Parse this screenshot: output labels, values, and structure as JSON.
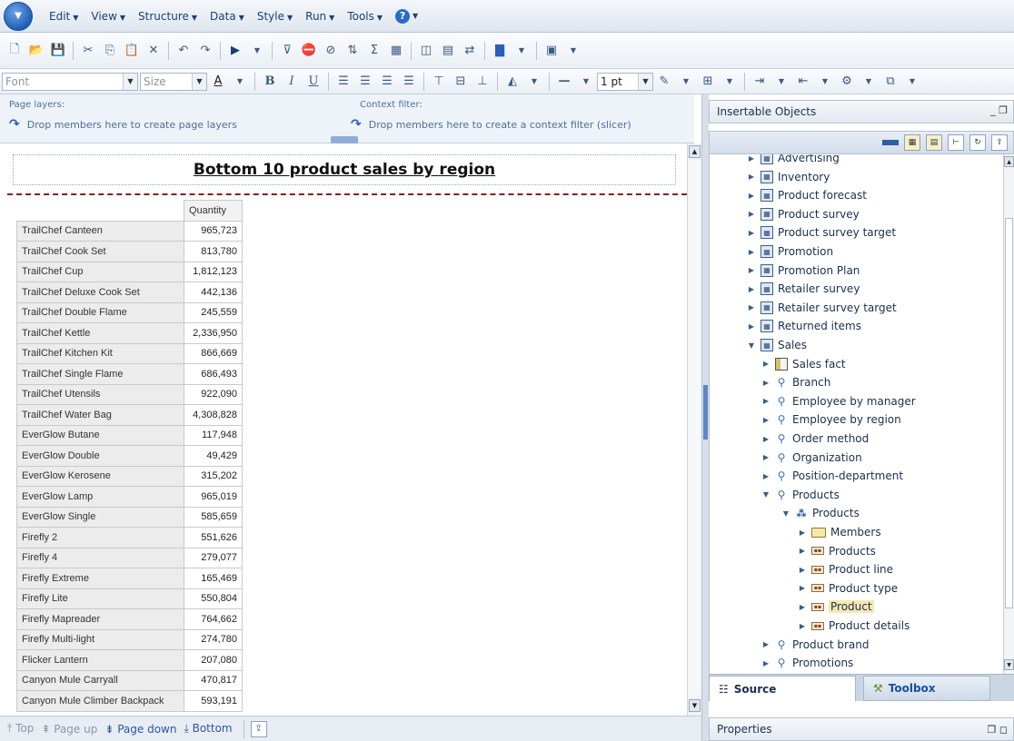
{
  "menu": {
    "items": [
      "Edit",
      "View",
      "Structure",
      "Data",
      "Style",
      "Run",
      "Tools"
    ]
  },
  "toolbar2": {
    "font_placeholder": "Font",
    "size_placeholder": "Size",
    "line_width": "1 pt",
    "bold": "B",
    "italic": "I",
    "underline": "U"
  },
  "layers": {
    "page_title": "Page layers:",
    "page_hint": "Drop members here to create page layers",
    "context_title": "Context filter:",
    "context_hint": "Drop members here to create a context filter (slicer)"
  },
  "report": {
    "title": "Bottom 10 product sales by region",
    "column_header": "Quantity",
    "rows": [
      {
        "label": "TrailChef Canteen",
        "value": "965,723"
      },
      {
        "label": "TrailChef Cook Set",
        "value": "813,780"
      },
      {
        "label": "TrailChef Cup",
        "value": "1,812,123"
      },
      {
        "label": "TrailChef Deluxe Cook Set",
        "value": "442,136"
      },
      {
        "label": "TrailChef Double Flame",
        "value": "245,559"
      },
      {
        "label": "TrailChef Kettle",
        "value": "2,336,950"
      },
      {
        "label": "TrailChef Kitchen Kit",
        "value": "866,669"
      },
      {
        "label": "TrailChef Single Flame",
        "value": "686,493"
      },
      {
        "label": "TrailChef Utensils",
        "value": "922,090"
      },
      {
        "label": "TrailChef Water Bag",
        "value": "4,308,828"
      },
      {
        "label": "EverGlow Butane",
        "value": "117,948"
      },
      {
        "label": "EverGlow Double",
        "value": "49,429"
      },
      {
        "label": "EverGlow Kerosene",
        "value": "315,202"
      },
      {
        "label": "EverGlow Lamp",
        "value": "965,019"
      },
      {
        "label": "EverGlow Single",
        "value": "585,659"
      },
      {
        "label": "Firefly 2",
        "value": "551,626"
      },
      {
        "label": "Firefly 4",
        "value": "279,077"
      },
      {
        "label": "Firefly Extreme",
        "value": "165,469"
      },
      {
        "label": "Firefly Lite",
        "value": "550,804"
      },
      {
        "label": "Firefly Mapreader",
        "value": "764,662"
      },
      {
        "label": "Firefly Multi-light",
        "value": "274,780"
      },
      {
        "label": "Flicker Lantern",
        "value": "207,080"
      },
      {
        "label": "Canyon Mule Carryall",
        "value": "470,817"
      },
      {
        "label": "Canyon Mule Climber Backpack",
        "value": "593,191"
      }
    ]
  },
  "page_nav": {
    "top": "Top",
    "page_up": "Page up",
    "page_down": "Page down",
    "bottom": "Bottom"
  },
  "insertable": {
    "title": "Insertable Objects"
  },
  "tree": [
    {
      "label": "Advertising",
      "level": 0,
      "icon": "qs",
      "expanded": false
    },
    {
      "label": "Inventory",
      "level": 0,
      "icon": "qs",
      "expanded": false
    },
    {
      "label": "Product forecast",
      "level": 0,
      "icon": "qs",
      "expanded": false
    },
    {
      "label": "Product survey",
      "level": 0,
      "icon": "qs",
      "expanded": false
    },
    {
      "label": "Product survey target",
      "level": 0,
      "icon": "qs",
      "expanded": false
    },
    {
      "label": "Promotion",
      "level": 0,
      "icon": "qs",
      "expanded": false
    },
    {
      "label": "Promotion Plan",
      "level": 0,
      "icon": "qs",
      "expanded": false
    },
    {
      "label": "Retailer survey",
      "level": 0,
      "icon": "qs",
      "expanded": false
    },
    {
      "label": "Retailer survey target",
      "level": 0,
      "icon": "qs",
      "expanded": false
    },
    {
      "label": "Returned items",
      "level": 0,
      "icon": "qs",
      "expanded": false
    },
    {
      "label": "Sales",
      "level": 0,
      "icon": "qs",
      "expanded": true
    },
    {
      "label": "Sales fact",
      "level": 1,
      "icon": "fact",
      "expanded": false
    },
    {
      "label": "Branch",
      "level": 1,
      "icon": "dim",
      "expanded": false
    },
    {
      "label": "Employee by manager",
      "level": 1,
      "icon": "dim",
      "expanded": false
    },
    {
      "label": "Employee by region",
      "level": 1,
      "icon": "dim",
      "expanded": false
    },
    {
      "label": "Order method",
      "level": 1,
      "icon": "dim",
      "expanded": false
    },
    {
      "label": "Organization",
      "level": 1,
      "icon": "dim",
      "expanded": false
    },
    {
      "label": "Position-department",
      "level": 1,
      "icon": "dim",
      "expanded": false
    },
    {
      "label": "Products",
      "level": 1,
      "icon": "dim",
      "expanded": true
    },
    {
      "label": "Products",
      "level": 2,
      "icon": "hier",
      "expanded": true
    },
    {
      "label": "Members",
      "level": 3,
      "icon": "folder",
      "expanded": false
    },
    {
      "label": "Products",
      "level": 3,
      "icon": "levelitem",
      "expanded": false
    },
    {
      "label": "Product line",
      "level": 3,
      "icon": "levelitem",
      "expanded": false
    },
    {
      "label": "Product type",
      "level": 3,
      "icon": "levelitem",
      "expanded": false
    },
    {
      "label": "Product",
      "level": 3,
      "icon": "levelitem",
      "expanded": false,
      "selected": true
    },
    {
      "label": "Product details",
      "level": 3,
      "icon": "levelitem",
      "expanded": false
    },
    {
      "label": "Product brand",
      "level": 1,
      "icon": "dim",
      "expanded": false
    },
    {
      "label": "Promotions",
      "level": 1,
      "icon": "dim",
      "expanded": false
    }
  ],
  "tabs": {
    "source": "Source",
    "toolbox": "Toolbox"
  },
  "properties": {
    "title": "Properties"
  }
}
